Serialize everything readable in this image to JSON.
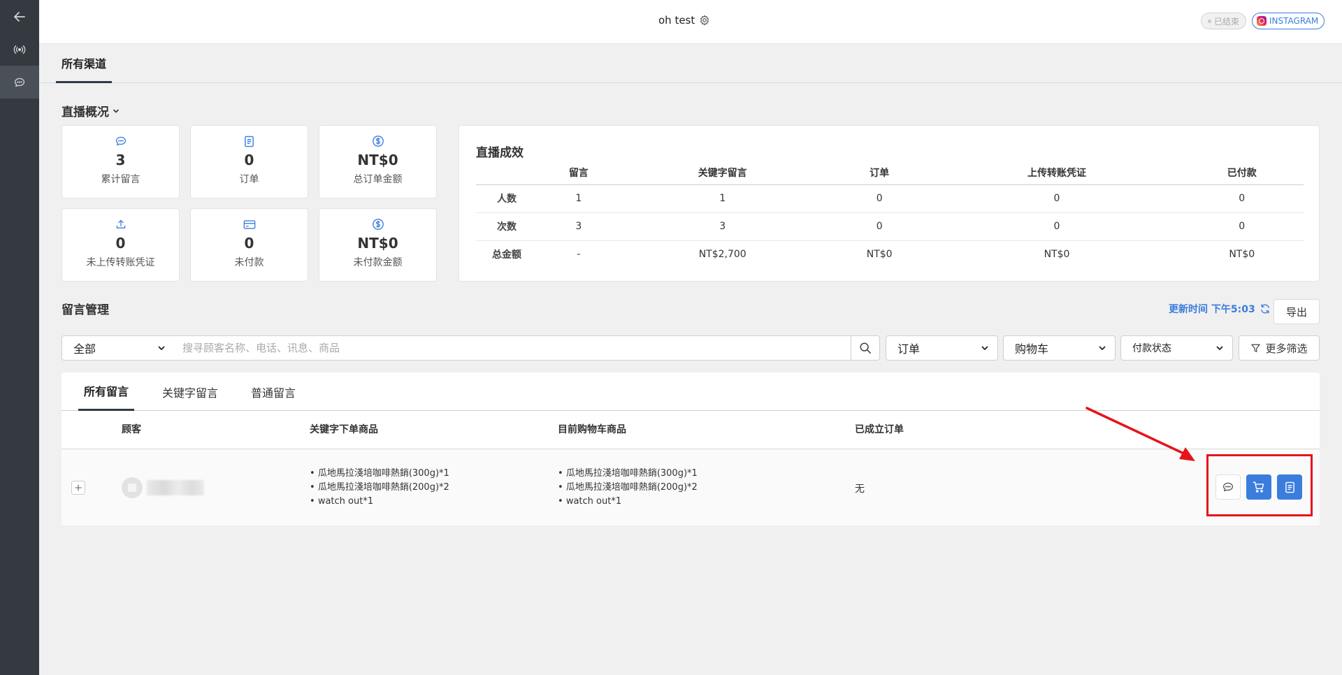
{
  "topbar": {
    "title": "oh test",
    "status_badge": "已结束",
    "platform_badge": "INSTAGRAM"
  },
  "channel_tabs": [
    "所有渠道"
  ],
  "overview": {
    "title": "直播概况",
    "stats": [
      {
        "icon": "comment-icon",
        "value": "3",
        "label": "累计留言"
      },
      {
        "icon": "order-icon",
        "value": "0",
        "label": "订单"
      },
      {
        "icon": "dollar-icon",
        "value": "NT$0",
        "label": "总订单金额"
      },
      {
        "icon": "upload-icon",
        "value": "0",
        "label": "未上传转账凭证"
      },
      {
        "icon": "card-icon",
        "value": "0",
        "label": "未付款"
      },
      {
        "icon": "dollar-icon",
        "value": "NT$0",
        "label": "未付款金额"
      }
    ]
  },
  "performance": {
    "title": "直播成效",
    "columns": [
      "留言",
      "关键字留言",
      "订单",
      "上传转账凭证",
      "已付款"
    ],
    "rows": [
      {
        "label": "人数",
        "values": [
          "1",
          "1",
          "0",
          "0",
          "0"
        ]
      },
      {
        "label": "次数",
        "values": [
          "3",
          "3",
          "0",
          "0",
          "0"
        ]
      },
      {
        "label": "总金额",
        "values": [
          "-",
          "NT$2,700",
          "NT$0",
          "NT$0",
          "NT$0"
        ]
      }
    ]
  },
  "comments": {
    "title": "留言管理",
    "refresh_label": "更新时间 下午5:03",
    "export_label": "导出",
    "scope_select": "全部",
    "search_placeholder": "搜寻顾客名称、电话、讯息、商品",
    "filters": [
      "订单",
      "购物车",
      "付款状态"
    ],
    "more_filters_label": "更多筛选",
    "tabs": [
      "所有留言",
      "关键字留言",
      "普通留言"
    ],
    "active_tab": "所有留言",
    "table_headers": [
      "顾客",
      "关键字下单商品",
      "目前购物车商品",
      "已成立订单"
    ],
    "rows": [
      {
        "keyword_products": [
          "瓜地馬拉淺培咖啡熱銷(300g)*1",
          "瓜地馬拉淺培咖啡熱銷(200g)*2",
          "watch out*1"
        ],
        "cart_products": [
          "瓜地馬拉淺培咖啡熱銷(300g)*1",
          "瓜地馬拉淺培咖啡熱銷(200g)*2",
          "watch out*1"
        ],
        "orders": "无"
      }
    ]
  },
  "colors": {
    "sidebar": "#343a40",
    "accent": "#3b7ddd",
    "annotation": "#e5141b"
  }
}
